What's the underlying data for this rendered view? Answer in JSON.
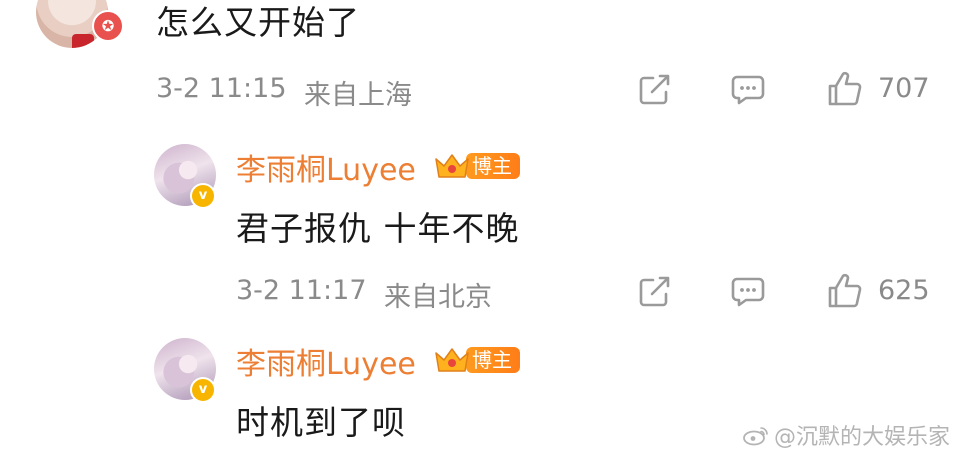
{
  "comment": {
    "text": "怎么又开始了",
    "time": "3-2 11:15",
    "location": "来自上海",
    "likes": "707",
    "badge_icon": "red-star-badge"
  },
  "replies": [
    {
      "username": "李雨桐Luyee",
      "badge": "博主",
      "text": "君子报仇 十年不晚",
      "time": "3-2 11:17",
      "location": "来自北京",
      "likes": "625"
    },
    {
      "username": "李雨桐Luyee",
      "badge": "博主",
      "text": "时机到了呗"
    }
  ],
  "watermark": "@沉默的大娱乐家",
  "colors": {
    "username": "#ec7f34",
    "meta": "#8a8a8a",
    "verified": "#f7b500",
    "blogger_badge": "#ff8a1e"
  }
}
